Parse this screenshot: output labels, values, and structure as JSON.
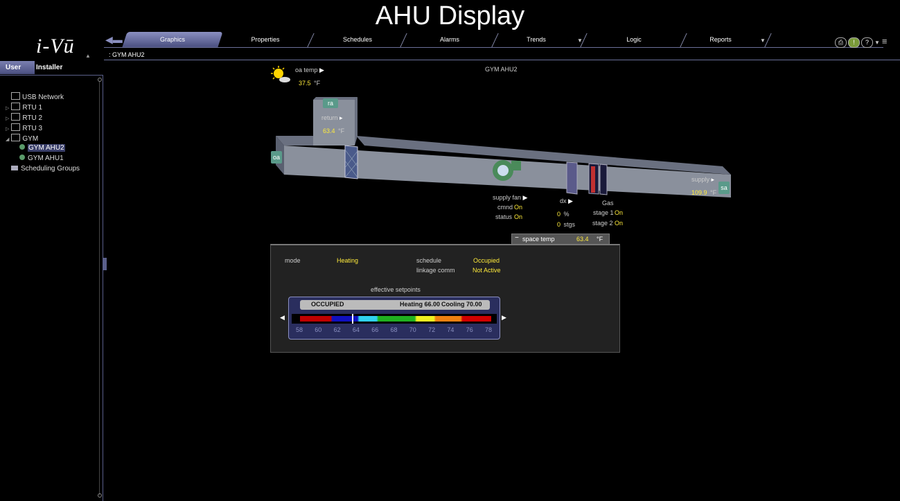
{
  "heading": "AHU Display",
  "logo": "i-Vū",
  "nav": {
    "tabs": [
      "Graphics",
      "Properties",
      "Schedules",
      "Alarms",
      "Trends",
      "Logic",
      "Reports"
    ],
    "active": "Graphics"
  },
  "breadcrumb": ": GYM AHU2",
  "panel_tabs": {
    "user": "User",
    "installer": "Installer"
  },
  "tree": [
    {
      "label": "USB Network",
      "kind": "net"
    },
    {
      "label": "RTU 1",
      "kind": "net"
    },
    {
      "label": "RTU 2",
      "kind": "net"
    },
    {
      "label": "RTU 3",
      "kind": "net"
    },
    {
      "label": "GYM",
      "kind": "net"
    },
    {
      "label": "GYM AHU2",
      "kind": "dev"
    },
    {
      "label": "GYM AHU1",
      "kind": "dev"
    },
    {
      "label": "Scheduling Groups",
      "kind": "folder"
    }
  ],
  "graphic": {
    "title": "GYM AHU2",
    "oa_temp": {
      "label": "oa temp",
      "value": "37.5",
      "unit": "°F"
    },
    "return": {
      "tag": "ra",
      "label": "return",
      "value": "63.4",
      "unit": "°F"
    },
    "oa_tag": "oa",
    "supply": {
      "tag": "sa",
      "label": "supply",
      "value": "109.9",
      "unit": "°F"
    },
    "supply_fan": {
      "label": "supply fan",
      "cmnd_label": "cmnd",
      "cmnd": "On",
      "status_label": "status",
      "status": "On"
    },
    "dx": {
      "label": "dx",
      "pct": "0",
      "pct_unit": "%",
      "stgs": "0",
      "stgs_unit": "stgs"
    },
    "gas": {
      "label": "Gas",
      "stage1_label": "stage 1",
      "stage1": "On",
      "stage2_label": "stage 2",
      "stage2": "On"
    }
  },
  "space_temp": {
    "label": "space temp",
    "value": "63.4",
    "unit": "°F"
  },
  "info": {
    "mode_label": "mode",
    "mode": "Heating",
    "schedule_label": "schedule",
    "schedule": "Occupied",
    "linkage_label": "linkage comm",
    "linkage": "Not Active",
    "setpoints_label": "effective setpoints"
  },
  "setpoint_bar": {
    "state": "OCCUPIED",
    "heating_label": "Heating",
    "heating": "66.00",
    "cooling_label": "Cooling",
    "cooling": "70.00",
    "scale": [
      "58",
      "60",
      "62",
      "64",
      "66",
      "68",
      "70",
      "72",
      "74",
      "76",
      "78"
    ]
  }
}
